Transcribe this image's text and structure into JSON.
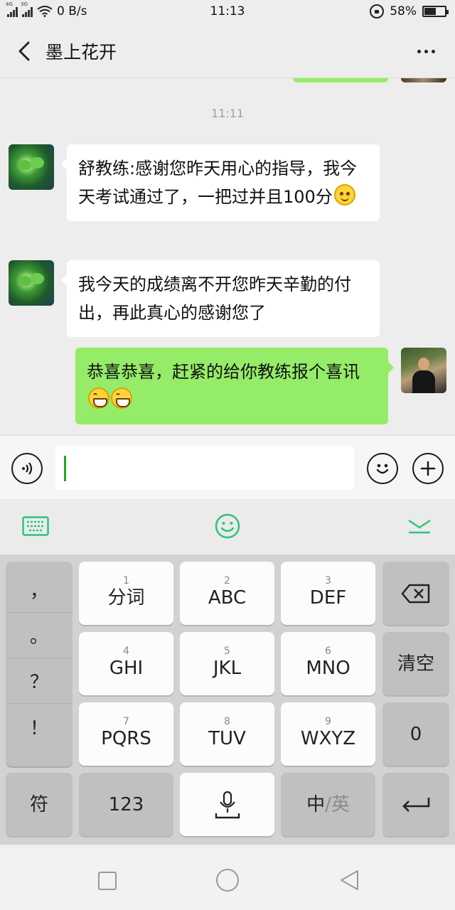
{
  "status_bar": {
    "net_rate": "0 B/s",
    "time": "11:13",
    "battery": "58%",
    "battery_level": 0.58,
    "signal_tags": [
      "4G",
      "3G"
    ]
  },
  "header": {
    "title": "墨上花开"
  },
  "chat": {
    "timestamp": "11:11",
    "messages": [
      {
        "direction": "in",
        "text": "舒教练:感谢您昨天用心的指导，我今天考试通过了，一把过并且100分",
        "emoji": [
          "smile"
        ]
      },
      {
        "direction": "in",
        "text": "我今天的成绩离不开您昨天辛勤的付出，再此真心的感谢您了",
        "emoji": []
      },
      {
        "direction": "out",
        "text": "恭喜恭喜，赶紧的给你教练报个喜讯",
        "emoji": [
          "grin",
          "grin"
        ]
      }
    ]
  },
  "input": {
    "value": "",
    "icons": [
      "voice-icon",
      "emoji-icon",
      "plus-icon"
    ]
  },
  "keyboard": {
    "toolbar_icons": [
      "keyboard-icon",
      "emoji-icon",
      "collapse-icon"
    ],
    "punctuation": [
      "，",
      "。",
      "？",
      "！"
    ],
    "keys": [
      {
        "num": "1",
        "label": "分词"
      },
      {
        "num": "2",
        "label": "ABC"
      },
      {
        "num": "3",
        "label": "DEF"
      },
      {
        "num": "4",
        "label": "GHI"
      },
      {
        "num": "5",
        "label": "JKL"
      },
      {
        "num": "6",
        "label": "MNO"
      },
      {
        "num": "7",
        "label": "PQRS"
      },
      {
        "num": "8",
        "label": "TUV"
      },
      {
        "num": "9",
        "label": "WXYZ"
      }
    ],
    "side": {
      "clear": "清空",
      "zero": "0"
    },
    "bottom": {
      "symbols": "符",
      "numbers": "123",
      "lang_cn": "中",
      "lang_sep": "/",
      "lang_en": "英"
    }
  },
  "colors": {
    "accent": "#1aad19",
    "sent_bubble": "#95ec69",
    "keyboard_accent": "#2ec47c"
  }
}
